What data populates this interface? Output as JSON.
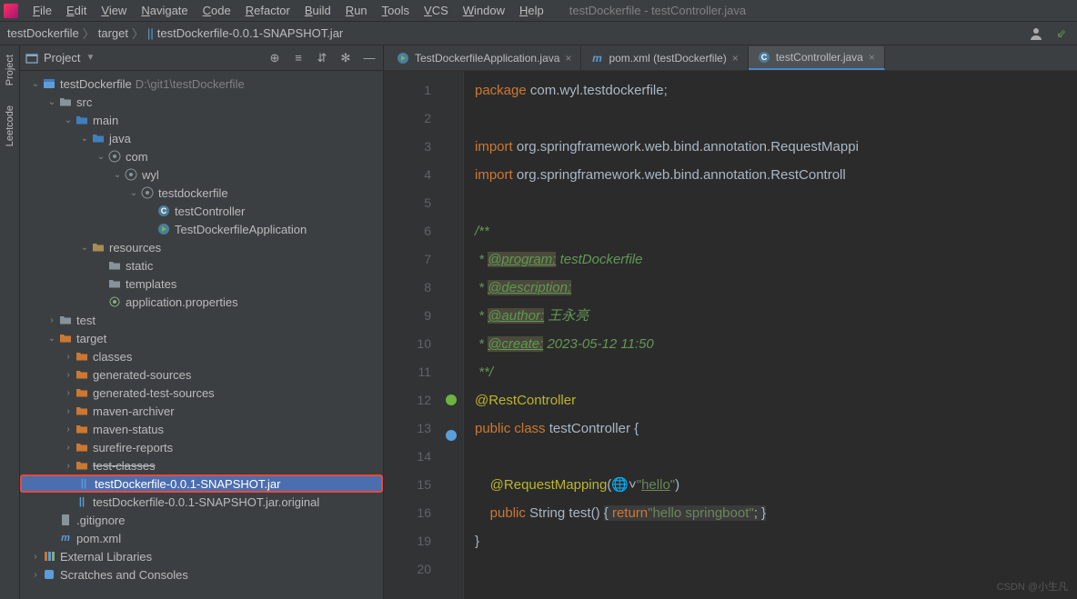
{
  "window": {
    "title": "testDockerfile - testController.java"
  },
  "menu": [
    "File",
    "Edit",
    "View",
    "Navigate",
    "Code",
    "Refactor",
    "Build",
    "Run",
    "Tools",
    "VCS",
    "Window",
    "Help"
  ],
  "breadcrumbs": [
    {
      "label": "testDockerfile",
      "icon": "project"
    },
    {
      "label": "target",
      "icon": ""
    },
    {
      "label": "testDockerfile-0.0.1-SNAPSHOT.jar",
      "icon": "jar"
    }
  ],
  "sidebar": {
    "title": "Project",
    "tool_tabs": [
      "Project",
      "Leetcode"
    ],
    "tree": [
      {
        "depth": 0,
        "arrow": "v",
        "icon": "project",
        "label": "testDockerfile",
        "path": "D:\\git1\\testDockerfile"
      },
      {
        "depth": 1,
        "arrow": "v",
        "icon": "folder",
        "label": "src"
      },
      {
        "depth": 2,
        "arrow": "v",
        "icon": "folder-src",
        "label": "main"
      },
      {
        "depth": 3,
        "arrow": "v",
        "icon": "folder-src",
        "label": "java"
      },
      {
        "depth": 4,
        "arrow": "v",
        "icon": "package",
        "label": "com"
      },
      {
        "depth": 5,
        "arrow": "v",
        "icon": "package",
        "label": "wyl"
      },
      {
        "depth": 6,
        "arrow": "v",
        "icon": "package",
        "label": "testdockerfile"
      },
      {
        "depth": 7,
        "arrow": "",
        "icon": "class",
        "label": "testController"
      },
      {
        "depth": 7,
        "arrow": "",
        "icon": "class-run",
        "label": "TestDockerfileApplication"
      },
      {
        "depth": 3,
        "arrow": "v",
        "icon": "folder-res",
        "label": "resources"
      },
      {
        "depth": 4,
        "arrow": "",
        "icon": "folder",
        "label": "static"
      },
      {
        "depth": 4,
        "arrow": "",
        "icon": "folder",
        "label": "templates"
      },
      {
        "depth": 4,
        "arrow": "",
        "icon": "props",
        "label": "application.properties"
      },
      {
        "depth": 1,
        "arrow": ">",
        "icon": "folder",
        "label": "test"
      },
      {
        "depth": 1,
        "arrow": "v",
        "icon": "folder-target",
        "label": "target"
      },
      {
        "depth": 2,
        "arrow": ">",
        "icon": "folder-target",
        "label": "classes"
      },
      {
        "depth": 2,
        "arrow": ">",
        "icon": "folder-target",
        "label": "generated-sources"
      },
      {
        "depth": 2,
        "arrow": ">",
        "icon": "folder-target",
        "label": "generated-test-sources"
      },
      {
        "depth": 2,
        "arrow": ">",
        "icon": "folder-target",
        "label": "maven-archiver"
      },
      {
        "depth": 2,
        "arrow": ">",
        "icon": "folder-target",
        "label": "maven-status"
      },
      {
        "depth": 2,
        "arrow": ">",
        "icon": "folder-target",
        "label": "surefire-reports"
      },
      {
        "depth": 2,
        "arrow": ">",
        "icon": "folder-target",
        "label": "test-classes",
        "strike": true
      },
      {
        "depth": 2,
        "arrow": "",
        "icon": "jar",
        "label": "testDockerfile-0.0.1-SNAPSHOT.jar",
        "selected": true,
        "boxed": true
      },
      {
        "depth": 2,
        "arrow": "",
        "icon": "jar",
        "label": "testDockerfile-0.0.1-SNAPSHOT.jar.original"
      },
      {
        "depth": 1,
        "arrow": "",
        "icon": "file",
        "label": ".gitignore"
      },
      {
        "depth": 1,
        "arrow": "",
        "icon": "maven",
        "label": "pom.xml"
      },
      {
        "depth": 0,
        "arrow": ">",
        "icon": "lib",
        "label": "External Libraries"
      },
      {
        "depth": 0,
        "arrow": ">",
        "icon": "scratch",
        "label": "Scratches and Consoles"
      }
    ]
  },
  "tabs": [
    {
      "label": "TestDockerfileApplication.java",
      "icon": "class-run",
      "active": false
    },
    {
      "label": "pom.xml (testDockerfile)",
      "icon": "maven",
      "active": false
    },
    {
      "label": "testController.java",
      "icon": "class",
      "active": true
    }
  ],
  "code": {
    "lines": [
      {
        "n": 1,
        "html": "<span class='kw'>package</span> <span class='imp'>com.wyl.testdockerfile</span>;"
      },
      {
        "n": 2,
        "html": ""
      },
      {
        "n": 3,
        "html": "<span class='kw'>import</span> <span class='imp'>org.springframework.web.bind.annotation.</span><span class='cls'>RequestMappi</span>"
      },
      {
        "n": 4,
        "html": "<span class='kw'>import</span> <span class='imp'>org.springframework.web.bind.annotation.</span><span class='cls'>RestControll</span>"
      },
      {
        "n": 5,
        "html": ""
      },
      {
        "n": 6,
        "html": "<span class='jdoc'>/**</span>"
      },
      {
        "n": 7,
        "html": "<span class='jdoc'> * </span><span class='jdoctag'>@program:</span><span class='jdoc'> testDockerfile</span>"
      },
      {
        "n": 8,
        "html": "<span class='jdoc'> * </span><span class='jdoctag'>@description:</span>"
      },
      {
        "n": 9,
        "html": "<span class='jdoc'> * </span><span class='jdoctag'>@author:</span><span class='jdoc'> 王永亮</span>"
      },
      {
        "n": 10,
        "html": "<span class='jdoc'> * </span><span class='jdoctag'>@create:</span><span class='jdoc'> 2023-05-12 11:50</span>"
      },
      {
        "n": 11,
        "html": "<span class='jdoc'> **/</span>"
      },
      {
        "n": 12,
        "html": "<span class='ann'>@RestController</span>",
        "gicon": "spring"
      },
      {
        "n": 13,
        "html": "<span class='kw'>public</span> <span class='kw'>class</span> <span class='cls'>testController</span> {",
        "gicon": "bean"
      },
      {
        "n": 14,
        "html": ""
      },
      {
        "n": 15,
        "html": "    <span class='ann'>@RequestMapping</span>(<span style='color:#888'>🌐</span>˅<span class='str'>\"<span class='hl'>hello</span>\"</span>)"
      },
      {
        "n": 16,
        "html": "    <span class='kw'>public</span> <span class='cls'>String</span> <span class='cls'>test</span>() <span class='retblock'>{ <span class='kw'>return</span><span class='str'>\"hello springboot\"</span>; }</span>"
      },
      {
        "n": 19,
        "html": "}"
      },
      {
        "n": 20,
        "html": ""
      }
    ]
  },
  "watermark": "CSDN @小生凡"
}
